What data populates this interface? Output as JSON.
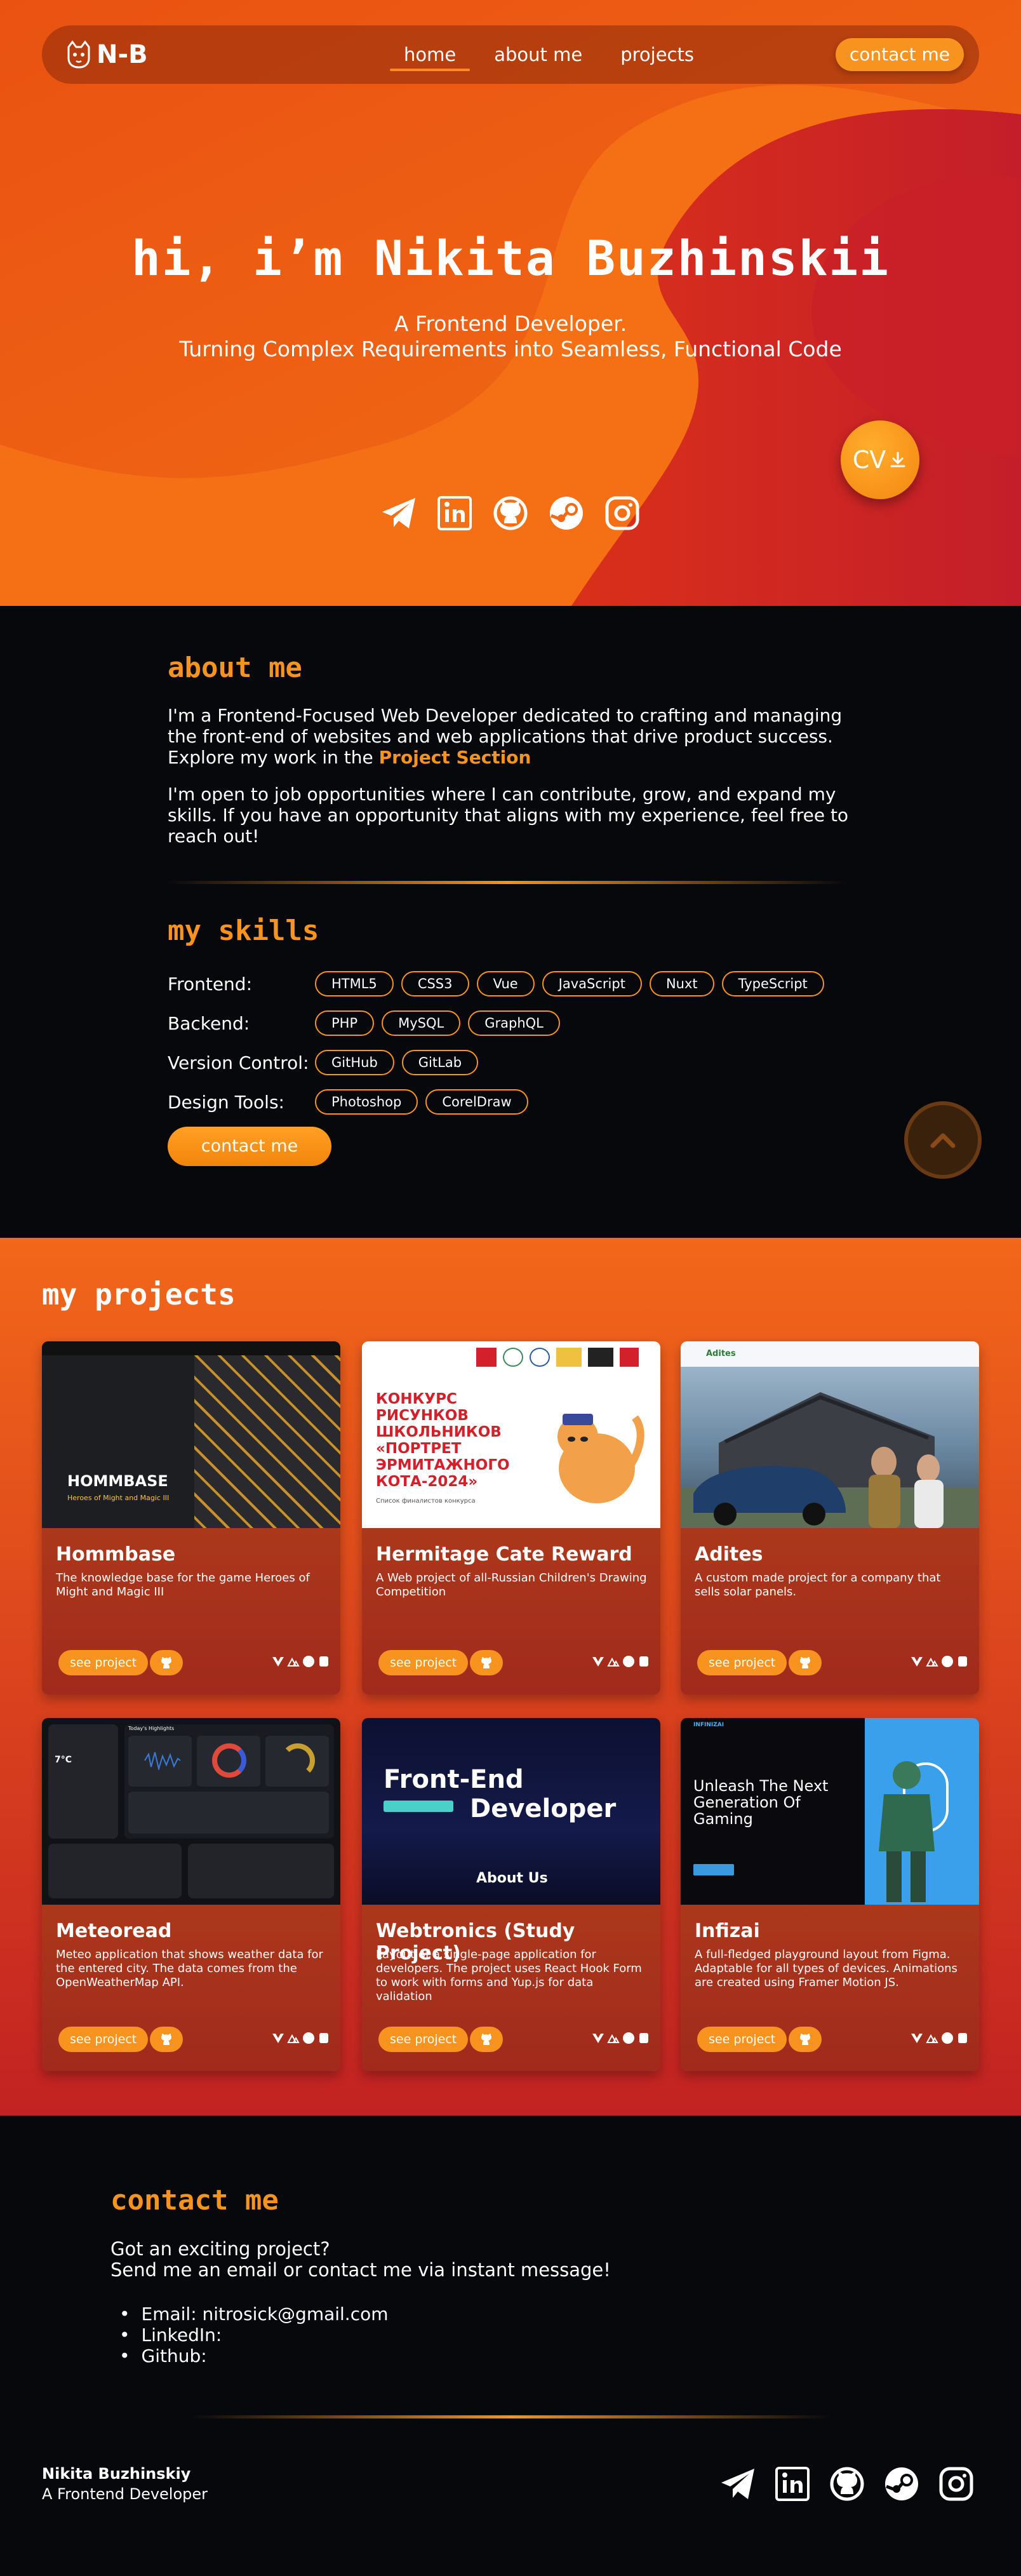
{
  "nav": {
    "logo_text": "N-B",
    "links": [
      {
        "label": "home",
        "active": true
      },
      {
        "label": "about me",
        "active": false
      },
      {
        "label": "projects",
        "active": false
      }
    ],
    "contact_label": "contact me"
  },
  "hero": {
    "title": "hi, i’m Nikita Buzhinskii",
    "subtitle_line1": "A Frontend Developer.",
    "subtitle_line2": "Turning Complex Requirements into Seamless, Functional Code",
    "cv_label": "CV",
    "socials": [
      "telegram-icon",
      "linkedin-icon",
      "github-icon",
      "steam-icon",
      "instagram-icon"
    ]
  },
  "about": {
    "heading": "about me",
    "p1_text": "I'm a Frontend-Focused Web Developer dedicated to crafting and managing the front-end  of websites and web applications that drive product success. Explore my work in the ",
    "p1_link": "Project Section",
    "p2": "I'm open to job opportunities where I can contribute, grow, and expand my skills. If you have an opportunity that aligns with my experience, feel free to reach out!",
    "skills_heading": "my skills",
    "skills": [
      {
        "label": "Frontend:",
        "items": [
          "HTML5",
          "CSS3",
          "Vue",
          "JavaScript",
          "Nuxt",
          "TypeScript"
        ]
      },
      {
        "label": "Backend:",
        "items": [
          "PHP",
          "MySQL",
          "GraphQL"
        ]
      },
      {
        "label": "Version Control:",
        "items": [
          "GitHub",
          "GitLab"
        ]
      },
      {
        "label": "Design Tools:",
        "items": [
          "Photoshop",
          "CorelDraw"
        ]
      }
    ],
    "contact_label": "contact me"
  },
  "projects": {
    "heading": "my projects",
    "see_label": "see project",
    "items": [
      {
        "name": "Hommbase",
        "desc": "The knowledge base for the game Heroes of Might and Magic III",
        "thumb_title": "HOMMBASE",
        "thumb_sub": "Heroes of Might and Magic III"
      },
      {
        "name": "Hermitage Cate Reward",
        "desc": "A Web project of all-Russian Children's Drawing Competition",
        "thumb_title": "КОНКУРС РИСУНКОВ ШКОЛЬНИКОВ «ПОРТРЕТ ЭРМИТАЖНОГО КОТА-2024»",
        "thumb_sub": "Список финалистов конкурса"
      },
      {
        "name": "Adites",
        "desc": "A custom made project for a company that sells solar panels.",
        "thumb_title": "Adites",
        "thumb_sub": ""
      },
      {
        "name": "Meteoread",
        "desc": "Meteo application that shows weather data for the entered city. The data comes from the OpenWeatherMap API.",
        "thumb_title": "7°C",
        "thumb_sub": "Today's Highlights"
      },
      {
        "name": "Webtronics (Study Project)",
        "desc": "Layout of a single-page application for developers. The project uses React Hook Form to work with forms and Yup.js for data validation",
        "thumb_title": "Front-End",
        "thumb_sub": "Developer",
        "thumb_extra": "About Us"
      },
      {
        "name": "Infizai",
        "desc": "A full-fledged playground layout from Figma. Adaptable for all types of devices. Animations are created using Framer Motion JS.",
        "thumb_title": "Unleash The Next Generation Of Gaming",
        "thumb_sub": "INFINIZAI"
      }
    ]
  },
  "contact": {
    "heading": "contact me",
    "intro_line1": "Got an exciting project?",
    "intro_line2": "Send me an email or contact me via instant message!",
    "list": [
      "Email: nitrosick@gmail.com",
      "LinkedIn:",
      "Github:"
    ]
  },
  "footer": {
    "name": "Nikita Buzhinskiy",
    "role": "A Frontend Developer"
  },
  "colors": {
    "accent": "#f7931e",
    "dark": "#07080c",
    "hero": "#f25e14"
  }
}
